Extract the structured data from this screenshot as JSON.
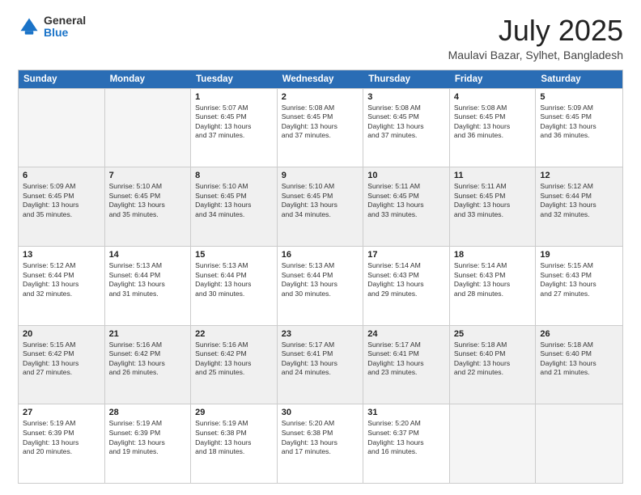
{
  "logo": {
    "general": "General",
    "blue": "Blue"
  },
  "title": {
    "main": "July 2025",
    "sub": "Maulavi Bazar, Sylhet, Bangladesh"
  },
  "header_days": [
    "Sunday",
    "Monday",
    "Tuesday",
    "Wednesday",
    "Thursday",
    "Friday",
    "Saturday"
  ],
  "weeks": [
    [
      {
        "day": "",
        "empty": true
      },
      {
        "day": "",
        "empty": true
      },
      {
        "day": "1",
        "lines": [
          "Sunrise: 5:07 AM",
          "Sunset: 6:45 PM",
          "Daylight: 13 hours",
          "and 37 minutes."
        ]
      },
      {
        "day": "2",
        "lines": [
          "Sunrise: 5:08 AM",
          "Sunset: 6:45 PM",
          "Daylight: 13 hours",
          "and 37 minutes."
        ]
      },
      {
        "day": "3",
        "lines": [
          "Sunrise: 5:08 AM",
          "Sunset: 6:45 PM",
          "Daylight: 13 hours",
          "and 37 minutes."
        ]
      },
      {
        "day": "4",
        "lines": [
          "Sunrise: 5:08 AM",
          "Sunset: 6:45 PM",
          "Daylight: 13 hours",
          "and 36 minutes."
        ]
      },
      {
        "day": "5",
        "lines": [
          "Sunrise: 5:09 AM",
          "Sunset: 6:45 PM",
          "Daylight: 13 hours",
          "and 36 minutes."
        ]
      }
    ],
    [
      {
        "day": "6",
        "lines": [
          "Sunrise: 5:09 AM",
          "Sunset: 6:45 PM",
          "Daylight: 13 hours",
          "and 35 minutes."
        ]
      },
      {
        "day": "7",
        "lines": [
          "Sunrise: 5:10 AM",
          "Sunset: 6:45 PM",
          "Daylight: 13 hours",
          "and 35 minutes."
        ]
      },
      {
        "day": "8",
        "lines": [
          "Sunrise: 5:10 AM",
          "Sunset: 6:45 PM",
          "Daylight: 13 hours",
          "and 34 minutes."
        ]
      },
      {
        "day": "9",
        "lines": [
          "Sunrise: 5:10 AM",
          "Sunset: 6:45 PM",
          "Daylight: 13 hours",
          "and 34 minutes."
        ]
      },
      {
        "day": "10",
        "lines": [
          "Sunrise: 5:11 AM",
          "Sunset: 6:45 PM",
          "Daylight: 13 hours",
          "and 33 minutes."
        ]
      },
      {
        "day": "11",
        "lines": [
          "Sunrise: 5:11 AM",
          "Sunset: 6:45 PM",
          "Daylight: 13 hours",
          "and 33 minutes."
        ]
      },
      {
        "day": "12",
        "lines": [
          "Sunrise: 5:12 AM",
          "Sunset: 6:44 PM",
          "Daylight: 13 hours",
          "and 32 minutes."
        ]
      }
    ],
    [
      {
        "day": "13",
        "lines": [
          "Sunrise: 5:12 AM",
          "Sunset: 6:44 PM",
          "Daylight: 13 hours",
          "and 32 minutes."
        ]
      },
      {
        "day": "14",
        "lines": [
          "Sunrise: 5:13 AM",
          "Sunset: 6:44 PM",
          "Daylight: 13 hours",
          "and 31 minutes."
        ]
      },
      {
        "day": "15",
        "lines": [
          "Sunrise: 5:13 AM",
          "Sunset: 6:44 PM",
          "Daylight: 13 hours",
          "and 30 minutes."
        ]
      },
      {
        "day": "16",
        "lines": [
          "Sunrise: 5:13 AM",
          "Sunset: 6:44 PM",
          "Daylight: 13 hours",
          "and 30 minutes."
        ]
      },
      {
        "day": "17",
        "lines": [
          "Sunrise: 5:14 AM",
          "Sunset: 6:43 PM",
          "Daylight: 13 hours",
          "and 29 minutes."
        ]
      },
      {
        "day": "18",
        "lines": [
          "Sunrise: 5:14 AM",
          "Sunset: 6:43 PM",
          "Daylight: 13 hours",
          "and 28 minutes."
        ]
      },
      {
        "day": "19",
        "lines": [
          "Sunrise: 5:15 AM",
          "Sunset: 6:43 PM",
          "Daylight: 13 hours",
          "and 27 minutes."
        ]
      }
    ],
    [
      {
        "day": "20",
        "lines": [
          "Sunrise: 5:15 AM",
          "Sunset: 6:42 PM",
          "Daylight: 13 hours",
          "and 27 minutes."
        ]
      },
      {
        "day": "21",
        "lines": [
          "Sunrise: 5:16 AM",
          "Sunset: 6:42 PM",
          "Daylight: 13 hours",
          "and 26 minutes."
        ]
      },
      {
        "day": "22",
        "lines": [
          "Sunrise: 5:16 AM",
          "Sunset: 6:42 PM",
          "Daylight: 13 hours",
          "and 25 minutes."
        ]
      },
      {
        "day": "23",
        "lines": [
          "Sunrise: 5:17 AM",
          "Sunset: 6:41 PM",
          "Daylight: 13 hours",
          "and 24 minutes."
        ]
      },
      {
        "day": "24",
        "lines": [
          "Sunrise: 5:17 AM",
          "Sunset: 6:41 PM",
          "Daylight: 13 hours",
          "and 23 minutes."
        ]
      },
      {
        "day": "25",
        "lines": [
          "Sunrise: 5:18 AM",
          "Sunset: 6:40 PM",
          "Daylight: 13 hours",
          "and 22 minutes."
        ]
      },
      {
        "day": "26",
        "lines": [
          "Sunrise: 5:18 AM",
          "Sunset: 6:40 PM",
          "Daylight: 13 hours",
          "and 21 minutes."
        ]
      }
    ],
    [
      {
        "day": "27",
        "lines": [
          "Sunrise: 5:19 AM",
          "Sunset: 6:39 PM",
          "Daylight: 13 hours",
          "and 20 minutes."
        ]
      },
      {
        "day": "28",
        "lines": [
          "Sunrise: 5:19 AM",
          "Sunset: 6:39 PM",
          "Daylight: 13 hours",
          "and 19 minutes."
        ]
      },
      {
        "day": "29",
        "lines": [
          "Sunrise: 5:19 AM",
          "Sunset: 6:38 PM",
          "Daylight: 13 hours",
          "and 18 minutes."
        ]
      },
      {
        "day": "30",
        "lines": [
          "Sunrise: 5:20 AM",
          "Sunset: 6:38 PM",
          "Daylight: 13 hours",
          "and 17 minutes."
        ]
      },
      {
        "day": "31",
        "lines": [
          "Sunrise: 5:20 AM",
          "Sunset: 6:37 PM",
          "Daylight: 13 hours",
          "and 16 minutes."
        ]
      },
      {
        "day": "",
        "empty": true
      },
      {
        "day": "",
        "empty": true
      }
    ]
  ]
}
